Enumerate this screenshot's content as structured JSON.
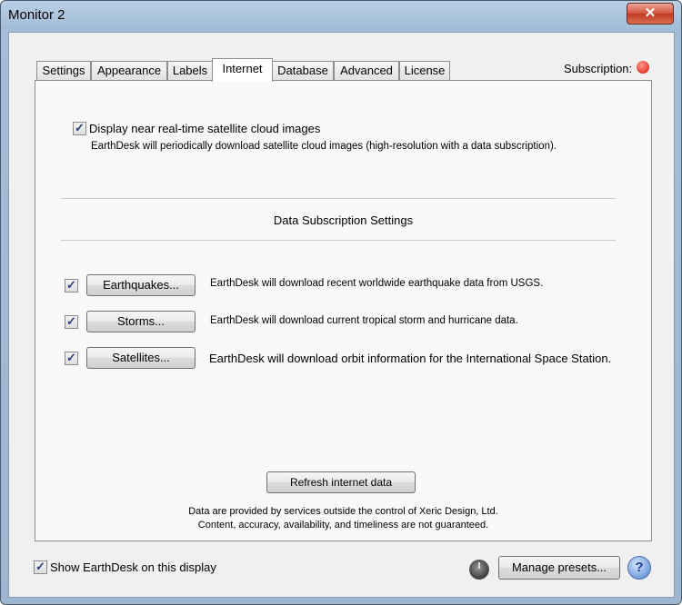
{
  "window": {
    "title": "Monitor 2",
    "close_glyph": "✕"
  },
  "tabs": [
    "Settings",
    "Appearance",
    "Labels",
    "Internet",
    "Database",
    "Advanced",
    "License"
  ],
  "active_tab": "Internet",
  "subscription": {
    "label": "Subscription:",
    "status_color": "#e8382b"
  },
  "cloud_images": {
    "checked": true,
    "label": "Display near real-time satellite cloud images",
    "description": "EarthDesk will periodically download satellite cloud images (high-resolution with a data subscription)."
  },
  "data_subscription": {
    "heading": "Data Subscription Settings",
    "items": [
      {
        "checked": true,
        "button": "Earthquakes...",
        "description": "EarthDesk will download recent worldwide earthquake data from USGS."
      },
      {
        "checked": true,
        "button": "Storms...",
        "description": "EarthDesk will download current tropical storm and hurricane data."
      },
      {
        "checked": true,
        "button": "Satellites...",
        "description": "EarthDesk will download orbit information for the International Space Station."
      }
    ]
  },
  "refresh_button": "Refresh internet data",
  "disclaimer": {
    "line1": "Data are provided by services outside the control of Xeric Design, Ltd.",
    "line2": "Content, accuracy, availability, and timeliness are not guaranteed."
  },
  "footer": {
    "show_checked": true,
    "show_label": "Show EarthDesk on this display",
    "presets_button": "Manage presets...",
    "help_glyph": "?"
  },
  "check_glyph": "✓"
}
